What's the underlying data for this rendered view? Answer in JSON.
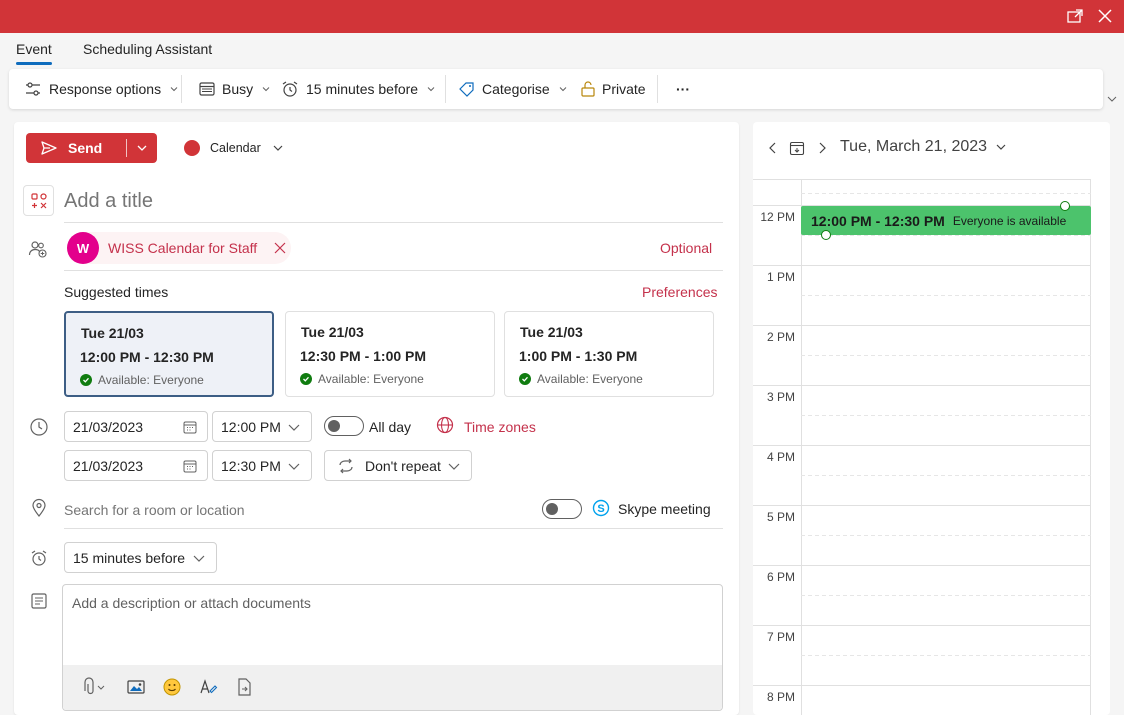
{
  "window": {
    "accent": "#d13438"
  },
  "tabs": {
    "event": "Event",
    "scheduling": "Scheduling Assistant"
  },
  "ribbon": {
    "response_options": "Response options",
    "busy": "Busy",
    "reminder": "15 minutes before",
    "categorise": "Categorise",
    "private": "Private",
    "more": "···"
  },
  "compose": {
    "send_label": "Send",
    "calendar_label": "Calendar",
    "title_placeholder": "Add a title",
    "attendee": {
      "initial": "W",
      "name": "WISS Calendar for Staff"
    },
    "optional_label": "Optional",
    "suggested_label": "Suggested times",
    "preferences_label": "Preferences",
    "suggestions": [
      {
        "date": "Tue 21/03",
        "time": "12:00 PM - 12:30 PM",
        "availability": "Available: Everyone"
      },
      {
        "date": "Tue 21/03",
        "time": "12:30 PM - 1:00 PM",
        "availability": "Available: Everyone"
      },
      {
        "date": "Tue 21/03",
        "time": "1:00 PM - 1:30 PM",
        "availability": "Available: Everyone"
      }
    ],
    "start_date": "21/03/2023",
    "start_time": "12:00 PM",
    "end_date": "21/03/2023",
    "end_time": "12:30 PM",
    "all_day_label": "All day",
    "time_zones_label": "Time zones",
    "repeat_label": "Don't repeat",
    "location_placeholder": "Search for a room or location",
    "skype_label": "Skype meeting",
    "reminder_value": "15 minutes before",
    "description_placeholder": "Add a description or attach documents"
  },
  "calendar": {
    "date_label": "Tue, March 21, 2023",
    "hours": [
      "12 PM",
      "1 PM",
      "2 PM",
      "3 PM",
      "4 PM",
      "5 PM",
      "6 PM",
      "7 PM",
      "8 PM"
    ],
    "event_time": "12:00 PM - 12:30 PM",
    "event_status": "Everyone is available",
    "event_color": "#4cc36c"
  }
}
